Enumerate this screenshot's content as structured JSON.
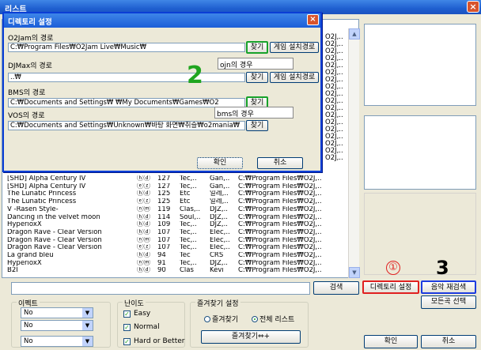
{
  "window": {
    "title": "리스트",
    "close": "×"
  },
  "list_rows": [
    [
      "[SHD] Alpha Century IV",
      "ⓗⓓ",
      "127",
      "Tec,..",
      "Gan,..",
      "C:₩Program Files₩O2J,.."
    ],
    [
      "[SHD] Alpha Century IV",
      "ⓔⓩ",
      "127",
      "Tec,..",
      "Gan,..",
      "C:₩Program Files₩O2J,.."
    ],
    [
      "The Lunatic Princess",
      "ⓗⓓ",
      "125",
      "Etc",
      "일레,..",
      "C:₩Program Files₩O2J,.."
    ],
    [
      "The Lunatic Princess",
      "ⓔⓩ",
      "125",
      "Etc",
      "일레,..",
      "C:₩Program Files₩O2J,.."
    ],
    [
      "V -Rasen Style-",
      "ⓝⓜ",
      "119",
      "Clas,..",
      "DJZ,..",
      "C:₩Program Files₩O2J,.."
    ],
    [
      "Dancing in the velvet moon",
      "ⓗⓓ",
      "114",
      "Soul,..",
      "DJZ,..",
      "C:₩Program Files₩O2J,.."
    ],
    [
      "HyperioxX",
      "ⓗⓓ",
      "109",
      "Tec,..",
      "DJZ,..",
      "C:₩Program Files₩O2J,.."
    ],
    [
      "Dragon Rave - Clear Version",
      "ⓗⓓ",
      "107",
      "Tec,..",
      "Elec,..",
      "C:₩Program Files₩O2J,.."
    ],
    [
      "Dragon Rave - Clear Version",
      "ⓝⓜ",
      "107",
      "Tec,..",
      "Elec,..",
      "C:₩Program Files₩O2J,.."
    ],
    [
      "Dragon Rave - Clear Version",
      "ⓔⓩ",
      "107",
      "Tec,..",
      "Elec,..",
      "C:₩Program Files₩O2J,.."
    ],
    [
      "La grand bleu",
      "ⓗⓓ",
      "94",
      "Tec",
      "CRS",
      "C:₩Program Files₩O2J,.."
    ],
    [
      "HyperioxX",
      "ⓝⓜ",
      "91",
      "Tec,..",
      "DJZ,..",
      "C:₩Program Files₩O2J,.."
    ],
    [
      "B2I",
      "ⓗⓓ",
      "90",
      "Clas",
      "Kevi",
      "C:₩Program Files₩O2J,.."
    ]
  ],
  "hidden_rows_right": [
    "O2J,..",
    "O2J,..",
    "O2J,..",
    "O2J,..",
    "O2J,..",
    "O2J,..",
    "O2J,..",
    "O2J,..",
    "O2J,..",
    "O2J,..",
    "O2J,..",
    "O2J,..",
    "O2J,..",
    "O2J,..",
    "O2J,..",
    "O2J,..",
    "O2J,..",
    "O2J,.."
  ],
  "buttons": {
    "search": "검색",
    "directory": "디렉토리 설정",
    "rescan": "음악 재검색",
    "select_all": "모든곡 선택",
    "ok": "확인",
    "cancel": "취소",
    "favorites_add": "즐겨찾기⇔+"
  },
  "annotations": {
    "one": "①",
    "three": "3",
    "two": "2"
  },
  "effect": {
    "title": "이펙트",
    "values": [
      "No",
      "No",
      "No"
    ]
  },
  "difficulty": {
    "title": "난이도",
    "items": [
      "Easy",
      "Normal",
      "Hard or Better"
    ]
  },
  "favorites": {
    "title": "즐겨찾기 설정",
    "option1": "즐겨찾기",
    "option2": "전체 리스트"
  },
  "dialog": {
    "title": "디렉토리 설정",
    "close": "×",
    "o2jam_label": "O2Jam의 경로",
    "o2jam_path": "C:₩Program Files₩O2Jam Live₩Music₩",
    "djmax_label": "DJMax의 경로",
    "djmax_path": "..₩",
    "bms_label": "BMS의 경로",
    "bms_path": "C:₩Documents and Settings₩       ₩My Documents₩Games₩O2",
    "vos_label": "VOS의 경로",
    "vos_path": "C:₩Documents and Settings₩Unknown₩바탕 화면₩취슬₩o2mania₩",
    "find": "찾기",
    "game_path": "게임 설치경로",
    "note_ojn": "ojn의 경우",
    "note_bms": "bms의 경우",
    "ok": "확인",
    "cancel": "취소"
  }
}
